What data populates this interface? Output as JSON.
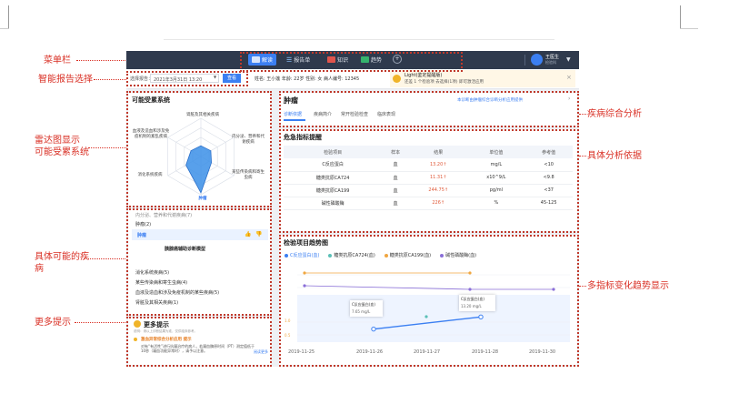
{
  "annotations": {
    "menubar": "菜单栏",
    "smart_report": "智能报告选择",
    "radar": "雷达图显示\n可能受累系统",
    "possible_disease": "具体可能的疾\n病",
    "more_tips": "更多提示",
    "disease_analysis": "疾病综合分析",
    "analysis_basis": "具体分析依据",
    "trend": "多指标变化趋势显示"
  },
  "topbar": {
    "tabs": [
      {
        "label": "解读",
        "active": true
      },
      {
        "label": "报告单"
      },
      {
        "label": "知识"
      },
      {
        "label": "趋势"
      }
    ],
    "add": "+",
    "user_name": "王医生",
    "user_dept": "检验科"
  },
  "context": {
    "report_label": "选择报告：",
    "report_value": "2021年3月31日 13:20",
    "query_btn": "查看",
    "patient": "姓名: 王小莲  年龄: 22岁  性别: 女  病人编号: 12345",
    "notice_title": "Light(鉴定提醒版)",
    "notice_text": "还差 1 个检验项  去选择(1项)  即可激活应用",
    "close": "×"
  },
  "radar": {
    "title": "可能受累系统",
    "labels": [
      "肾脏及其相关疾病",
      "内分泌、营养和代谢疾病",
      "某些传染病和寄生虫病",
      "肿瘤",
      "消化系统疾病",
      "血液及造血和涉及免疫机制的紊乱疾病"
    ],
    "values": [
      0.28,
      0.3,
      0.32,
      0.95,
      0.45,
      0.3
    ]
  },
  "disease_list": {
    "top_item": "内分泌、营养和代谢疾病(7)",
    "tumor_header": "肿瘤(2)",
    "selected": "肿瘤",
    "model": "胰腺癌辅助诊断模型",
    "items": [
      "消化系统疾病(5)",
      "某些传染病和寄生虫病(4)",
      "血液及造血和涉及免疫机制的某些疾病(5)",
      "肾脏及其相关疾病(1)"
    ]
  },
  "more": {
    "title": "更多提示",
    "subtitle": "说明：请以上诊断结果为准，仅供临床参考。",
    "item_title": "激血异常综合分析应用 提示",
    "item_text": "对有“有活性”进行抗凝治疗的病人，若凝血酶原时间（PT）测定值低于10秒（凝血功能异常时），请予以注意。",
    "link": "阅读更多"
  },
  "disease": {
    "title": "肿瘤",
    "hint": "本诊断由肿瘤综合诊断分析应用提供",
    "tabs": [
      "诊断依据",
      "疾病简介",
      "常开检验检查",
      "临床表现"
    ]
  },
  "table": {
    "title": "危急指标提醒",
    "headers": [
      "检验项目",
      "样本",
      "结果",
      "单位值",
      "参考值"
    ],
    "rows": [
      [
        "C反应蛋白",
        "血",
        "13.20↑",
        "mg/L",
        "<10"
      ],
      [
        "糖类抗原CA724",
        "血",
        "11.31↑",
        "x10^9/L",
        "<9.8"
      ],
      [
        "糖类抗原CA199",
        "血",
        "244.75↑",
        "pg/ml",
        "<37"
      ],
      [
        "碱性磷酸酶",
        "血",
        "226↑",
        "%",
        "45-125"
      ]
    ]
  },
  "trend": {
    "title": "检验项目趋势图",
    "legend": [
      "C反应蛋白(血)",
      "糖类抗原CA724(血)",
      "糖类抗原CA199(血)",
      "碱性磷酸酶(血)"
    ],
    "tip1": {
      "name": "C反应蛋白(血)",
      "value": "7.65 mg/L"
    },
    "tip2": {
      "name": "C反应蛋白(血)",
      "value": "13.20 mg/L"
    },
    "y_tick_labels": [
      "1.0",
      "0.5"
    ],
    "colors": [
      "#3b7ff2",
      "#8a6fd8",
      "#f0a640",
      "#5bc0b7"
    ]
  },
  "chart_data": {
    "type": "line",
    "x": [
      "2019-11-25",
      "2019-11-26",
      "2019-11-27",
      "2019-11-28",
      "2019-11-30"
    ],
    "series": [
      {
        "name": "C反应蛋白(血)",
        "values": [
          null,
          7.65,
          null,
          13.2,
          null
        ]
      },
      {
        "name": "糖类抗原CA724(血)",
        "values": [
          null,
          null,
          null,
          null,
          null
        ]
      },
      {
        "name": "糖类抗原CA199(血)",
        "values": [
          null,
          null,
          null,
          null,
          null
        ]
      },
      {
        "name": "碱性磷酸酶(血)",
        "values": [
          null,
          null,
          null,
          null,
          null
        ]
      }
    ]
  }
}
